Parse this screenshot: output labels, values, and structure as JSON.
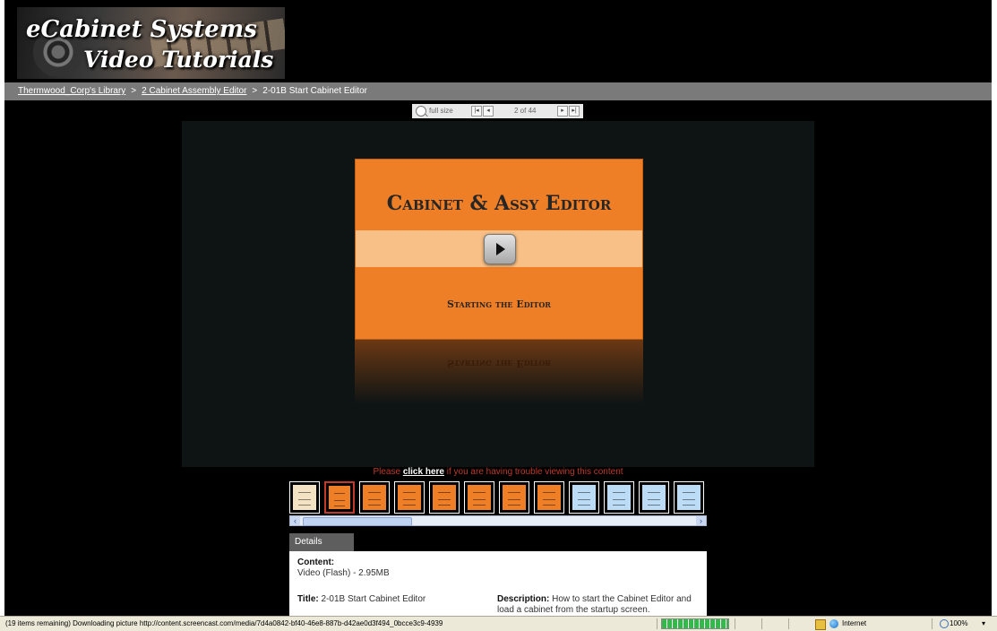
{
  "logo": {
    "line1": "eCabinet Systems",
    "line2": "Video Tutorials"
  },
  "breadcrumb": {
    "items": [
      "Thermwood_Corp's Library",
      "2 Cabinet Assembly Editor",
      "2-01B Start Cabinet Editor"
    ],
    "separator": ">"
  },
  "navigation": {
    "full_size_label": "full size",
    "first_icon": "first-page-icon",
    "prev_icon": "previous-page-icon",
    "next_icon": "next-page-icon",
    "last_icon": "last-page-icon",
    "page_indicator": "2 of 44"
  },
  "slide": {
    "title": "Cabinet & Assy Editor",
    "subtitle": "Starting the Editor",
    "play_icon": "play-icon",
    "colors": {
      "main": "#ef7f27",
      "band": "#f8bf86"
    }
  },
  "trouble": {
    "prefix": "Please ",
    "link": "click here",
    "suffix": " if you are having trouble viewing this content"
  },
  "thumbnails": {
    "items": [
      {
        "color": "#f3e3c4",
        "kind": "intro"
      },
      {
        "color": "#ef7f27",
        "kind": "slide",
        "selected": true
      },
      {
        "color": "#ef7f27",
        "kind": "slide"
      },
      {
        "color": "#ef7f27",
        "kind": "slide"
      },
      {
        "color": "#ef7f27",
        "kind": "slide"
      },
      {
        "color": "#ef7f27",
        "kind": "slide"
      },
      {
        "color": "#ef7f27",
        "kind": "slide"
      },
      {
        "color": "#ef7f27",
        "kind": "slide"
      },
      {
        "color": "#bcdcf5",
        "kind": "screen"
      },
      {
        "color": "#bcdcf5",
        "kind": "screen"
      },
      {
        "color": "#bcdcf5",
        "kind": "screen"
      },
      {
        "color": "#bcdcf5",
        "kind": "screen"
      }
    ],
    "scroll_left_icon": "scroll-left-icon",
    "scroll_right_icon": "scroll-right-icon"
  },
  "details": {
    "tab_label": "Details",
    "content_label": "Content:",
    "content_value": "Video (Flash) - 2.95MB",
    "title_label": "Title:",
    "title_value": " 2-01B Start Cabinet Editor",
    "description_label": "Description:",
    "description_value": " How to start the Cabinet Editor and load a cabinet from the startup screen."
  },
  "status": {
    "message": "(19 items remaining) Downloading picture http://content.screencast.com/media/7d4a0842-bf40-46e8-887b-d42ae0d3f494_0bcce3c9-4939",
    "progress": 1.0,
    "zone": "Internet",
    "zoom": "100%"
  }
}
